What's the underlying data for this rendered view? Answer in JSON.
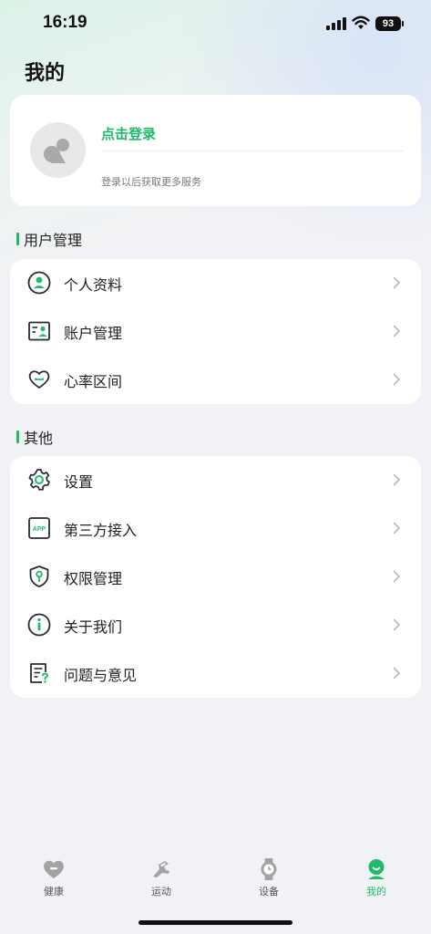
{
  "status_bar": {
    "time": "16:19",
    "battery": "93"
  },
  "page_title": "我的",
  "login": {
    "link_text": "点击登录",
    "subtitle": "登录以后获取更多服务"
  },
  "sections": {
    "user": {
      "title": "用户管理",
      "items": [
        {
          "label": "个人资料",
          "icon": "person-circle-icon"
        },
        {
          "label": "账户管理",
          "icon": "id-card-icon"
        },
        {
          "label": "心率区间",
          "icon": "heart-icon"
        }
      ]
    },
    "other": {
      "title": "其他",
      "items": [
        {
          "label": "设置",
          "icon": "gear-icon"
        },
        {
          "label": "第三方接入",
          "icon": "app-icon",
          "icon_text": "APP"
        },
        {
          "label": "权限管理",
          "icon": "shield-key-icon"
        },
        {
          "label": "关于我们",
          "icon": "info-icon"
        },
        {
          "label": "问题与意见",
          "icon": "feedback-icon"
        }
      ]
    }
  },
  "tabs": [
    {
      "label": "健康",
      "icon": "health-heart-icon",
      "active": false
    },
    {
      "label": "运动",
      "icon": "running-shoe-icon",
      "active": false
    },
    {
      "label": "设备",
      "icon": "watch-icon",
      "active": false
    },
    {
      "label": "我的",
      "icon": "profile-icon",
      "active": true
    }
  ],
  "colors": {
    "accent": "#1fba6a",
    "icon_dark": "#2b2b33",
    "inactive_tab": "#9a9a9a"
  }
}
